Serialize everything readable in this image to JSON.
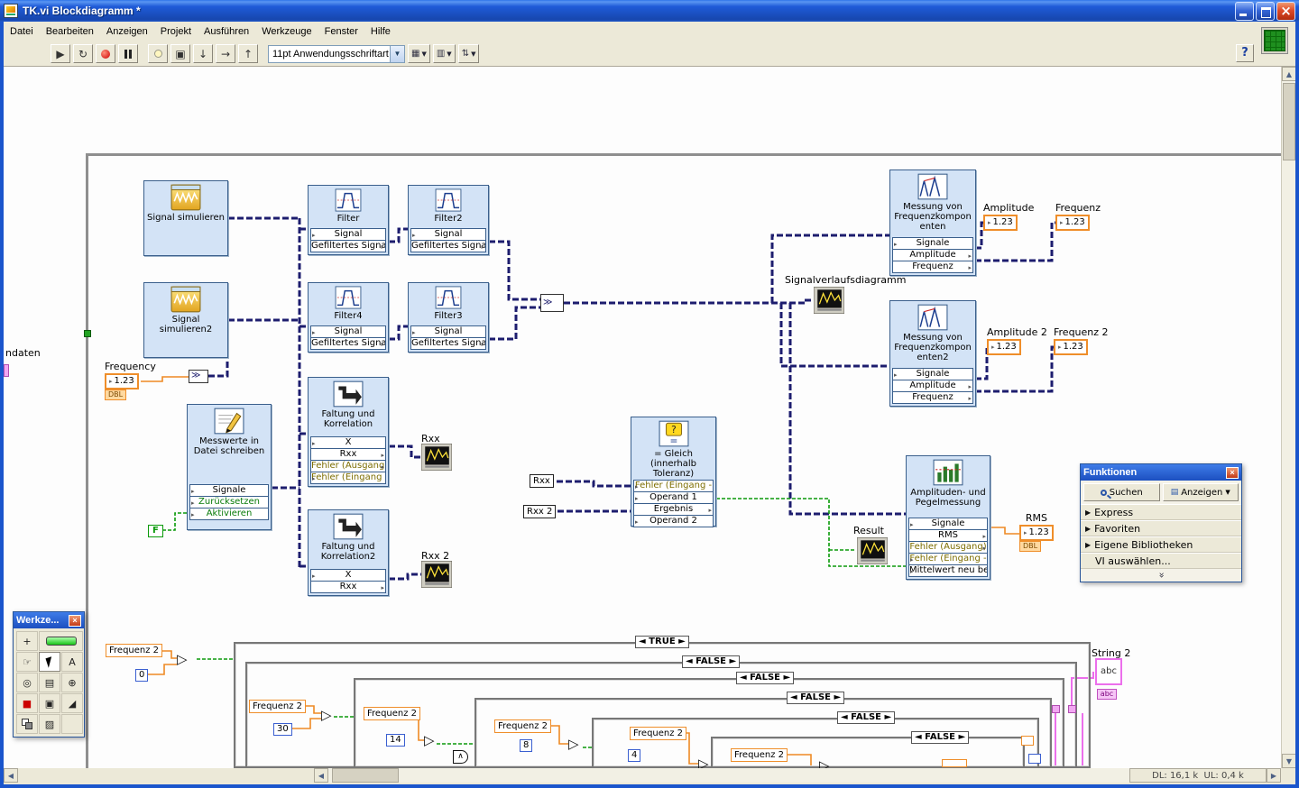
{
  "window": {
    "title": "TK.vi Blockdiagramm *"
  },
  "menu": [
    "Datei",
    "Bearbeiten",
    "Anzeigen",
    "Projekt",
    "Ausführen",
    "Werkzeuge",
    "Fenster",
    "Hilfe"
  ],
  "toolbar": {
    "font": "11pt Anwendungsschriftart",
    "help": "?"
  },
  "canvas": {
    "fragment_left": "ndaten",
    "merge": "≫",
    "nodes": {
      "sim1": {
        "title": "Signal simulieren"
      },
      "sim2": {
        "title": "Signal simulieren2"
      },
      "filter1": {
        "title": "Filter",
        "rows": [
          "Signal",
          "Gefiltertes Signal"
        ]
      },
      "filter2": {
        "title": "Filter2",
        "rows": [
          "Signal",
          "Gefiltertes Signal"
        ]
      },
      "filter3": {
        "title": "Filter3",
        "rows": [
          "Signal",
          "Gefiltertes Signal"
        ]
      },
      "filter4": {
        "title": "Filter4",
        "rows": [
          "Signal",
          "Gefiltertes Signal"
        ]
      },
      "mwrite": {
        "title": "Messwerte in Datei schreiben",
        "rows": [
          "Signale",
          "Zurücksetzen",
          "Aktivieren"
        ]
      },
      "falt1": {
        "title": "Faltung und Korrelation",
        "rows": [
          "X",
          "Rxx",
          "Fehler (Ausgang)",
          "Fehler (Eingang -"
        ]
      },
      "falt2": {
        "title": "Faltung und Korrelation2",
        "rows": [
          "X",
          "Rxx"
        ]
      },
      "mfk1": {
        "title": "Messung von Frequenzkomponenten",
        "rows": [
          "Signale",
          "Amplitude",
          "Frequenz"
        ]
      },
      "mfk2": {
        "title": "Messung von Frequenzkomponenten2",
        "rows": [
          "Signale",
          "Amplitude",
          "Frequenz"
        ]
      },
      "gleich": {
        "title": "= Gleich (innerhalb Toleranz)",
        "rows": [
          "Fehler (Eingang -",
          "Operand 1",
          "Ergebnis",
          "Operand 2"
        ]
      },
      "apm": {
        "title": "Amplituden- und Pegelmessung",
        "rows": [
          "Signale",
          "RMS",
          "Fehler (Ausgang)",
          "Fehler (Eingang -",
          "Mittelwert neu bei"
        ]
      }
    },
    "indicators": {
      "frequency": {
        "label": "Frequency",
        "value": "1.23",
        "type": "DBL"
      },
      "amplitude": {
        "label": "Amplitude",
        "value": "1.23"
      },
      "frequenz": {
        "label": "Frequenz",
        "value": "1.23"
      },
      "amplitude2": {
        "label": "Amplitude 2",
        "value": "1.23"
      },
      "frequenz2": {
        "label": "Frequenz 2",
        "value": "1.23"
      },
      "rms": {
        "label": "RMS",
        "value": "1.23",
        "type": "DBL"
      },
      "rxx": {
        "label": "Rxx"
      },
      "rxx2": {
        "label": "Rxx 2"
      },
      "wave": {
        "label": "Signalverlaufsdiagramm"
      },
      "result": {
        "label": "Result"
      },
      "string2": {
        "label": "String 2",
        "value": "abc",
        "badge": "abc"
      }
    },
    "locals": {
      "rxx": "Rxx",
      "rxx2": "Rxx 2",
      "bool": "F"
    },
    "cases": {
      "true": "◄ TRUE ►",
      "false": "◄ FALSE ►"
    },
    "freq2": {
      "label": "Frequenz 2",
      "v0": "0",
      "v1": "30",
      "v2": "14",
      "v3": "8",
      "v4": "4"
    }
  },
  "palettes": {
    "tools": {
      "title": "Werkze..."
    },
    "functions": {
      "title": "Funktionen",
      "search": "Suchen",
      "view": "Anzeigen",
      "items": [
        "Express",
        "Favoriten",
        "Eigene Bibliotheken"
      ],
      "select": "VI auswählen..."
    }
  },
  "status": {
    "transfer": "DL: 16,1 k  UL: 0,4 k"
  }
}
